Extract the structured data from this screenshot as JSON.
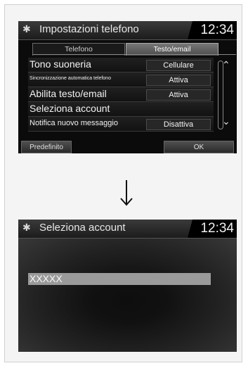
{
  "screen1": {
    "title": "Impostazioni telefono",
    "clock": "12:34",
    "tabs": [
      "Telefono",
      "Testo/email"
    ],
    "rows": [
      {
        "label": "Tono suoneria",
        "value": "Cellulare"
      },
      {
        "label": "Sincronizzazione automatica telefono",
        "value": "Attiva"
      },
      {
        "label": "Abilita testo/email",
        "value": "Attiva"
      },
      {
        "label": "Seleziona account",
        "value": ""
      },
      {
        "label": "Notifica nuovo messaggio",
        "value": "Disattiva"
      }
    ],
    "buttons": {
      "left": "Predefinito",
      "right": "OK"
    }
  },
  "screen2": {
    "title": "Seleziona account",
    "clock": "12:34",
    "account": "XXXXX"
  },
  "icons": {
    "gear": "gear-icon",
    "scroll_up": "chevron-up-icon",
    "scroll_down": "chevron-down-icon",
    "arrow": "arrow-down-icon"
  }
}
